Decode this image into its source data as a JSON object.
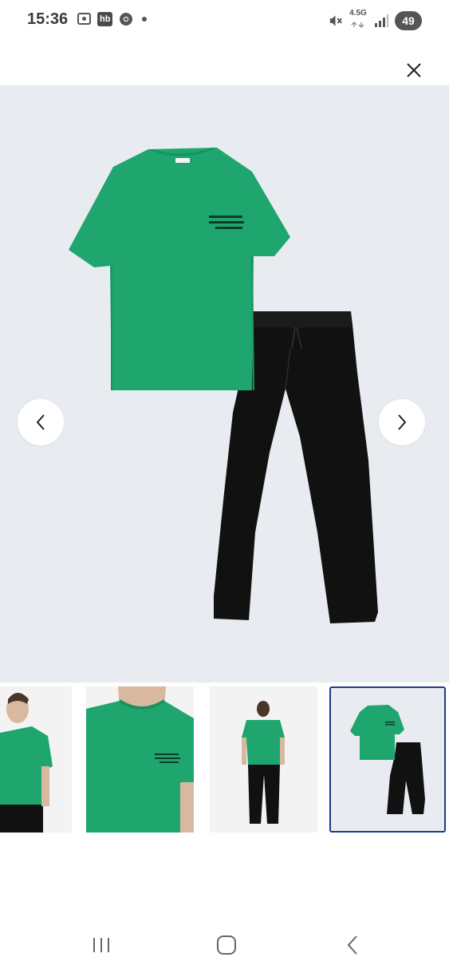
{
  "status_bar": {
    "time": "15:36",
    "badge_text": "hb",
    "network_label": "4.5G",
    "battery_level": "49"
  },
  "close_icon": "close-icon",
  "gallery": {
    "background_color": "#e8ebf0",
    "shirt_color": "#1ea66e",
    "pants_color": "#111111",
    "selected_thumbnail": 4,
    "thumbnail_count": 4,
    "selection_color": "#1e3a8a"
  },
  "nav": {
    "prev_icon": "chevron-left-icon",
    "next_icon": "chevron-right-icon"
  },
  "system_nav": {
    "recents_icon": "recents-icon",
    "home_icon": "home-icon",
    "back_icon": "back-icon"
  }
}
